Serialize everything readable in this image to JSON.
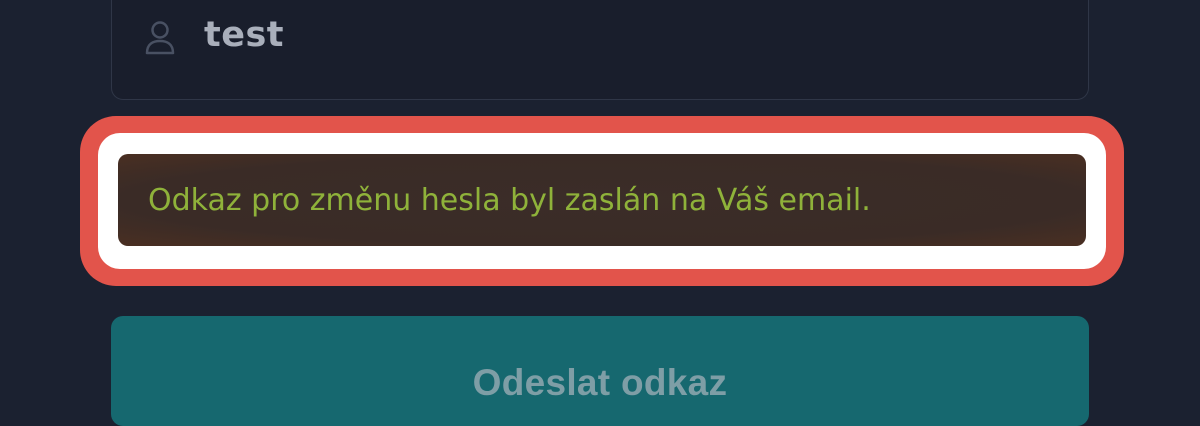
{
  "form": {
    "username_value": "test",
    "username_icon": "user-icon",
    "alert_message": "Odkaz pro změnu hesla byl zaslán na Váš email.",
    "submit_label": "Odeslat odkaz"
  },
  "colors": {
    "background": "#1b2130",
    "focus_ring": "#e2544b",
    "alert_text": "#8fb23a",
    "button": "#16686f"
  }
}
